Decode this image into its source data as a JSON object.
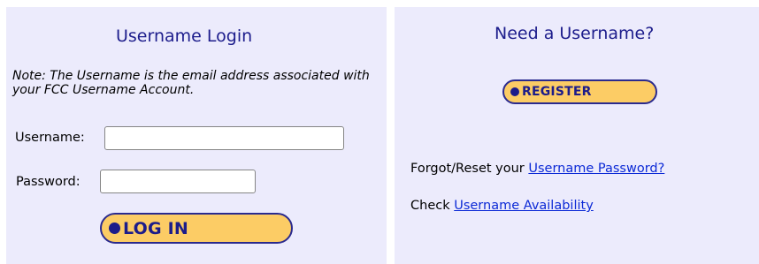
{
  "login_panel": {
    "title": "Username Login",
    "note": "Note: The Username is the email address associated with your FCC Username Account.",
    "username_label": "Username:",
    "username_value": "",
    "password_label": "Password:",
    "password_value": "",
    "login_button_label": "LOG IN"
  },
  "register_panel": {
    "title": "Need a Username?",
    "register_button_label": "REGISTER",
    "forgot_prefix": "Forgot/Reset your ",
    "forgot_link": "Username Password?",
    "check_prefix": "Check ",
    "check_link": "Username Availability"
  },
  "colors": {
    "panel_background": "#ecebfc",
    "heading": "#1d1d8c",
    "button_fill": "#fccc65",
    "button_text": "#1c1c8a",
    "link": "#0c2ad6"
  }
}
